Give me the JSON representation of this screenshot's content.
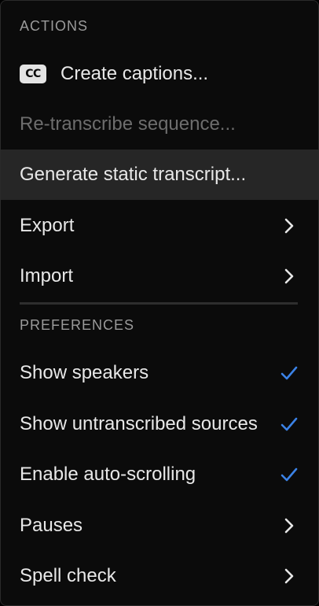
{
  "actions": {
    "header": "ACTIONS",
    "items": [
      {
        "label": "Create captions...",
        "icon": "cc-icon",
        "badge_text": "CC"
      },
      {
        "label": "Re-transcribe sequence..."
      },
      {
        "label": "Generate static transcript..."
      },
      {
        "label": "Export",
        "icon": "chevron-right-icon"
      },
      {
        "label": "Import",
        "icon": "chevron-right-icon"
      }
    ]
  },
  "preferences": {
    "header": "PREFERENCES",
    "items": [
      {
        "label": "Show speakers",
        "checked": true,
        "icon": "checkmark-icon"
      },
      {
        "label": "Show untranscribed sources",
        "checked": true,
        "icon": "checkmark-icon"
      },
      {
        "label": "Enable auto-scrolling",
        "checked": true,
        "icon": "checkmark-icon"
      },
      {
        "label": "Pauses",
        "icon": "chevron-right-icon"
      },
      {
        "label": "Spell check",
        "icon": "chevron-right-icon"
      }
    ]
  },
  "colors": {
    "background": "#0b0b0b",
    "highlight": "#262626",
    "text": "#e8e8e8",
    "disabled_text": "#6d6d6d",
    "section_header": "#9a9a9a",
    "checkmark": "#3b82e6"
  }
}
